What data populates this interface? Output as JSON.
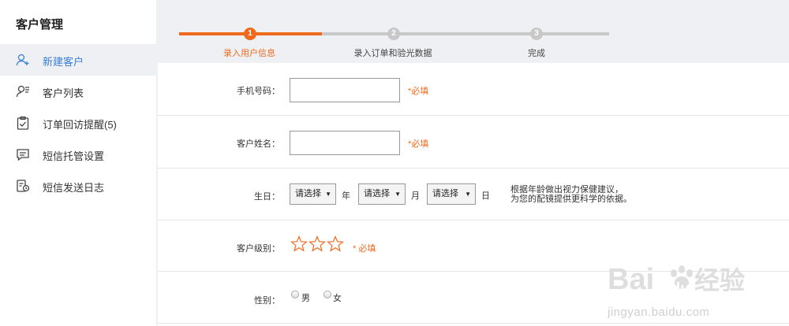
{
  "sidebar": {
    "title": "客户管理",
    "items": [
      {
        "label": "新建客户",
        "active": true
      },
      {
        "label": "客户列表"
      },
      {
        "label": "订单回访提醒(5)"
      },
      {
        "label": "短信托管设置"
      },
      {
        "label": "短信发送日志"
      }
    ]
  },
  "steps": [
    {
      "num": "1",
      "label": "录入用户信息"
    },
    {
      "num": "2",
      "label": "录入订单和验光数据"
    },
    {
      "num": "3",
      "label": "完成"
    }
  ],
  "form": {
    "phone_label": "手机号码：",
    "phone_value": "",
    "phone_required": "*必填",
    "name_label": "客户姓名：",
    "name_value": "",
    "name_required": "*必填",
    "birthday_label": "生日：",
    "year_select": "请选择",
    "year_unit": "年",
    "month_select": "请选择",
    "month_unit": "月",
    "day_select": "请选择",
    "day_unit": "日",
    "birthday_hint_line1": "根据年龄做出视力保健建议，",
    "birthday_hint_line2": "为您的配镜提供更科学的依据。",
    "level_label": "客户级别：",
    "level_stars_selected": 0,
    "level_stars_total": 3,
    "level_required": "* 必填",
    "gender_label": "性别：",
    "gender_male": "男",
    "gender_female": "女"
  },
  "watermark": {
    "brand": "Bai",
    "brand2": "du",
    "brand3": "经验",
    "url": "jingyan.baidu.com"
  },
  "colors": {
    "accent": "#f06a1e",
    "active_link": "#3a7fd5"
  }
}
